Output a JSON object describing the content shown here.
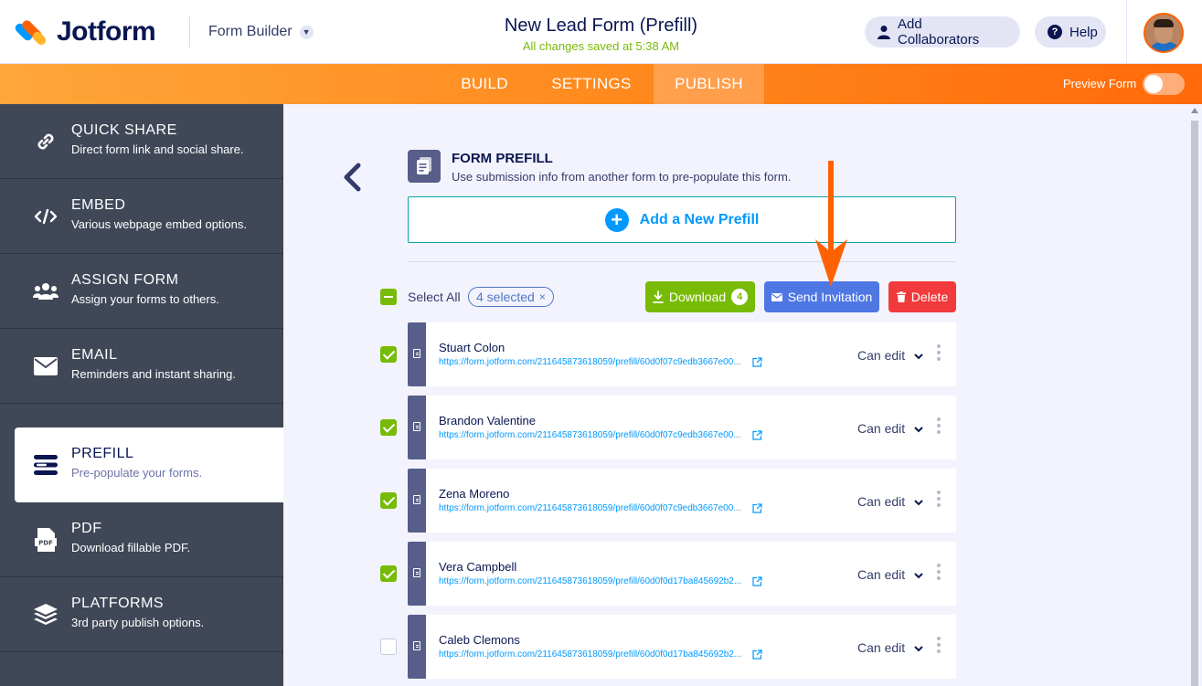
{
  "header": {
    "logo_text": "Jotform",
    "builder_dropdown": "Form Builder",
    "form_title": "New Lead Form (Prefill)",
    "save_status": "All changes saved at 5:38 AM",
    "add_collaborators": "Add Collaborators",
    "help": "Help"
  },
  "nav": {
    "tabs": [
      "BUILD",
      "SETTINGS",
      "PUBLISH"
    ],
    "active_tab": "PUBLISH",
    "preview_label": "Preview Form",
    "preview_on": false
  },
  "sidebar": {
    "items": [
      {
        "title": "QUICK SHARE",
        "desc": "Direct form link and social share.",
        "icon": "link-icon"
      },
      {
        "title": "EMBED",
        "desc": "Various webpage embed options.",
        "icon": "code-icon"
      },
      {
        "title": "ASSIGN FORM",
        "desc": "Assign your forms to others.",
        "icon": "users-icon"
      },
      {
        "title": "EMAIL",
        "desc": "Reminders and instant sharing.",
        "icon": "envelope-icon"
      },
      {
        "title": "PREFILL",
        "desc": "Pre-populate your forms.",
        "icon": "prefill-icon"
      },
      {
        "title": "PDF",
        "desc": "Download fillable PDF.",
        "icon": "pdf-icon"
      },
      {
        "title": "PLATFORMS",
        "desc": "3rd party publish options.",
        "icon": "layers-icon"
      }
    ],
    "active": "PREFILL"
  },
  "prefill": {
    "title": "FORM PREFILL",
    "description": "Use submission info from another form to pre-populate this form.",
    "add_button": "Add a New Prefill",
    "select_all_label": "Select All",
    "selected_chip": "4 selected",
    "chip_close": "×",
    "download_label": "Download",
    "download_count": "4",
    "send_invitation_label": "Send Invitation",
    "delete_label": "Delete",
    "rows": [
      {
        "name": "Stuart Colon",
        "link": "https://form.jotform.com/211645873618059/prefill/60d0f07c9edb3667e00...",
        "permission": "Can edit",
        "checked": true
      },
      {
        "name": "Brandon Valentine",
        "link": "https://form.jotform.com/211645873618059/prefill/60d0f07c9edb3667e00...",
        "permission": "Can edit",
        "checked": true
      },
      {
        "name": "Zena Moreno",
        "link": "https://form.jotform.com/211645873618059/prefill/60d0f07c9edb3667e00...",
        "permission": "Can edit",
        "checked": true
      },
      {
        "name": "Vera Campbell",
        "link": "https://form.jotform.com/211645873618059/prefill/60d0f0d17ba845692b2...",
        "permission": "Can edit",
        "checked": true
      },
      {
        "name": "Caleb Clemons",
        "link": "https://form.jotform.com/211645873618059/prefill/60d0f0d17ba845692b2...",
        "permission": "Can edit",
        "checked": false
      }
    ]
  },
  "colors": {
    "brand_orange": "#ff6100",
    "download_green": "#78bb07",
    "invite_blue": "#4e77e4",
    "delete_red": "#f23a3c",
    "sidebar_bg": "#404757"
  }
}
